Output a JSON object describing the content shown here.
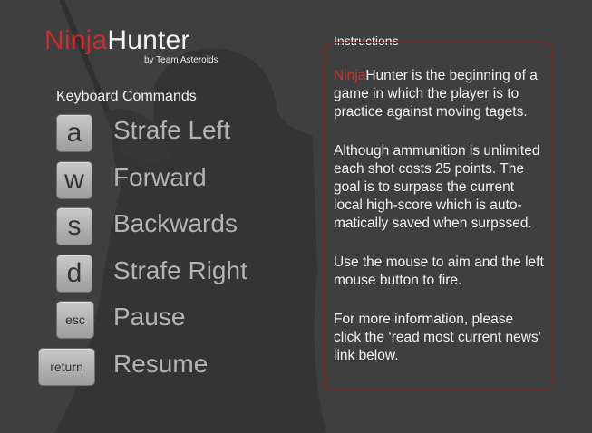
{
  "logo": {
    "ninja": "Ninja",
    "hunter": "Hunter",
    "byline": "by Team Asteroids"
  },
  "commands": {
    "heading": "Keyboard Commands",
    "items": [
      {
        "key": "a",
        "label": "Strafe Left"
      },
      {
        "key": "w",
        "label": "Forward"
      },
      {
        "key": "s",
        "label": "Backwards"
      },
      {
        "key": "d",
        "label": "Strafe Right"
      },
      {
        "key": "esc",
        "label": "Pause"
      },
      {
        "key": "return",
        "label": "Resume"
      }
    ]
  },
  "instructions": {
    "heading": "Instructions",
    "p1_ninja": "Ninja",
    "p1_rest": "Hunter is the beginning of a game in which the player is to practice against moving tagets.",
    "p2": "Although ammunition is unlimited each shot costs 25 points. The goal is to surpass the current local high-score which is auto-matically saved when surpssed.",
    "p3": "Use the mouse to aim and the left mouse button to fire.",
    "p4": "For more information, please click the ‘read most current news’ link below."
  },
  "colors": {
    "background": "#3f3f3f",
    "accent_red": "#d12a2a",
    "box_border": "#6a2b2b",
    "key_face": "#b5b5b5",
    "label_gray": "#b3b3b3"
  }
}
